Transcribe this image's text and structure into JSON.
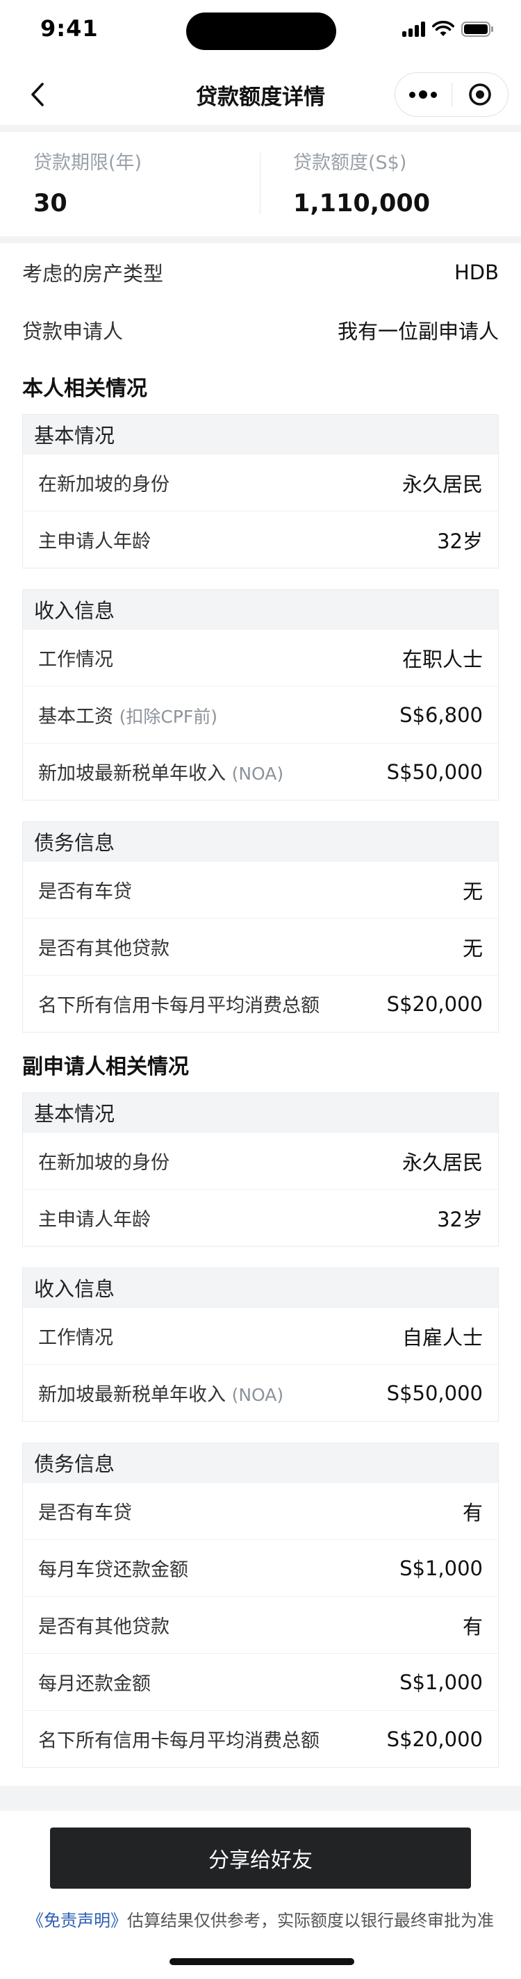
{
  "status_bar": {
    "time": "9:41"
  },
  "nav": {
    "title": "贷款额度详情"
  },
  "summary": {
    "items": [
      {
        "label": "贷款期限(年)",
        "value": "30"
      },
      {
        "label": "贷款额度(S$)",
        "value": "1,110,000"
      }
    ]
  },
  "overview": [
    {
      "label": "考虑的房产类型",
      "value": "HDB"
    },
    {
      "label": "贷款申请人",
      "value": "我有一位副申请人"
    }
  ],
  "self_section": {
    "title": "本人相关情况",
    "basic": {
      "title": "基本情况",
      "rows": [
        {
          "label": "在新加坡的身份",
          "value": "永久居民"
        },
        {
          "label": "主申请人年龄",
          "value": "32岁"
        }
      ]
    },
    "income": {
      "title": "收入信息",
      "rows": [
        {
          "label": "工作情况",
          "suffix": "",
          "value": "在职人士"
        },
        {
          "label": "基本工资",
          "suffix": "(扣除CPF前)",
          "value": "S$6,800"
        },
        {
          "label": "新加坡最新税单年收入",
          "suffix": "(NOA)",
          "value": "S$50,000"
        }
      ]
    },
    "debt": {
      "title": "债务信息",
      "rows": [
        {
          "label": "是否有车贷",
          "value": "无"
        },
        {
          "label": "是否有其他贷款",
          "value": "无"
        },
        {
          "label": "名下所有信用卡每月平均消费总额",
          "value": "S$20,000"
        }
      ]
    }
  },
  "co_section": {
    "title": "副申请人相关情况",
    "basic": {
      "title": "基本情况",
      "rows": [
        {
          "label": "在新加坡的身份",
          "value": "永久居民"
        },
        {
          "label": "主申请人年龄",
          "value": "32岁"
        }
      ]
    },
    "income": {
      "title": "收入信息",
      "rows": [
        {
          "label": "工作情况",
          "suffix": "",
          "value": "自雇人士"
        },
        {
          "label": "新加坡最新税单年收入",
          "suffix": "(NOA)",
          "value": "S$50,000"
        }
      ]
    },
    "debt": {
      "title": "债务信息",
      "rows": [
        {
          "label": "是否有车贷",
          "value": "有"
        },
        {
          "label": "每月车贷还款金额",
          "value": "S$1,000"
        },
        {
          "label": "是否有其他贷款",
          "value": "有"
        },
        {
          "label": "每月还款金额",
          "value": "S$1,000"
        },
        {
          "label": "名下所有信用卡每月平均消费总额",
          "value": "S$20,000"
        }
      ]
    }
  },
  "footer": {
    "share_label": "分享给好友",
    "disclaimer_link": "《免责声明》",
    "disclaimer_text": "估算结果仅供参考，实际额度以银行最终审批为准"
  },
  "colors": {
    "band_gray": "#f1f3f5",
    "button_dark": "#222325",
    "link_blue": "#2b5fb4",
    "muted_label": "#9aa0a8"
  },
  "icons": [
    "back-chevron-icon",
    "more-dots-icon",
    "target-close-icon",
    "signal-icon",
    "wifi-icon",
    "battery-icon"
  ]
}
